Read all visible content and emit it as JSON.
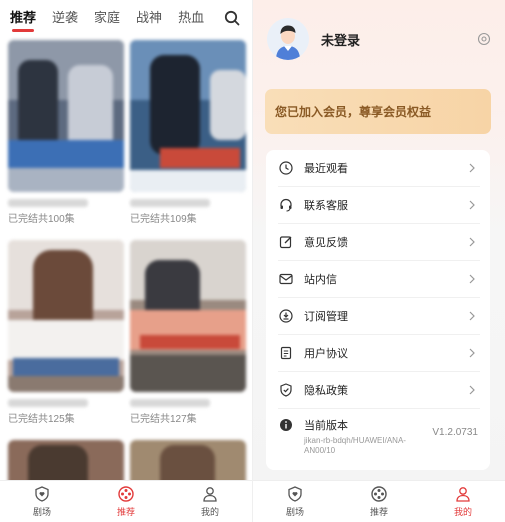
{
  "left": {
    "tabs": [
      "推荐",
      "逆袭",
      "家庭",
      "战神",
      "热血"
    ],
    "cards": [
      {
        "episodes": "已完结共100集"
      },
      {
        "episodes": "已完结共109集"
      },
      {
        "episodes": "已完结共125集"
      },
      {
        "episodes": "已完结共127集"
      }
    ],
    "nav": {
      "theater": "剧场",
      "recommend": "推荐",
      "mine": "我的"
    }
  },
  "right": {
    "username": "未登录",
    "member_banner": "您已加入会员，尊享会员权益",
    "menu": [
      {
        "label": "最近观看",
        "icon": "clock-icon"
      },
      {
        "label": "联系客服",
        "icon": "headset-icon"
      },
      {
        "label": "意见反馈",
        "icon": "edit-icon"
      },
      {
        "label": "站内信",
        "icon": "mail-icon"
      },
      {
        "label": "订阅管理",
        "icon": "subscribe-icon"
      },
      {
        "label": "用户协议",
        "icon": "document-icon"
      },
      {
        "label": "隐私政策",
        "icon": "shield-check-icon"
      }
    ],
    "version": {
      "label": "当前版本",
      "detail": "jikan-rb-bdqh/HUAWEI/ANA-AN00/10",
      "number": "V1.2.0731"
    },
    "nav": {
      "theater": "剧场",
      "recommend": "推荐",
      "mine": "我的"
    }
  },
  "colors": {
    "accent": "#e23a3a",
    "member_bg": "#f8d9b0",
    "member_text": "#8a5a25"
  }
}
